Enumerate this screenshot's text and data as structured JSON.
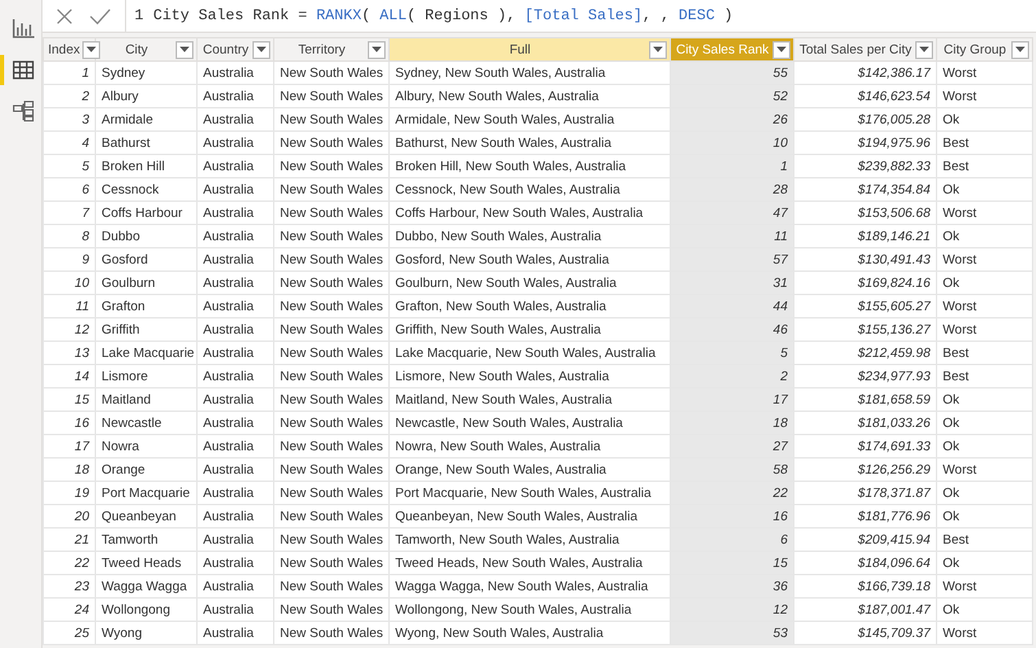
{
  "sidebar": {
    "items": [
      {
        "selected": false
      },
      {
        "selected": true
      },
      {
        "selected": false
      }
    ]
  },
  "formula_bar": {
    "line_number": "1",
    "tokens": [
      {
        "kind": "plain",
        "text": "City Sales Rank = "
      },
      {
        "kind": "function",
        "text": "RANKX"
      },
      {
        "kind": "plain",
        "text": "( "
      },
      {
        "kind": "function",
        "text": "ALL"
      },
      {
        "kind": "plain",
        "text": "( Regions ), "
      },
      {
        "kind": "function",
        "text": "[Total Sales]"
      },
      {
        "kind": "plain",
        "text": ", , "
      },
      {
        "kind": "function",
        "text": "DESC"
      },
      {
        "kind": "plain",
        "text": " )"
      }
    ]
  },
  "table": {
    "columns": [
      {
        "label": "Index",
        "kind": "number",
        "selected": false,
        "hovered": false
      },
      {
        "label": "City",
        "kind": "text",
        "selected": false,
        "hovered": false
      },
      {
        "label": "Country",
        "kind": "text",
        "selected": false,
        "hovered": false
      },
      {
        "label": "Territory",
        "kind": "text",
        "selected": false,
        "hovered": false
      },
      {
        "label": "Full",
        "kind": "text",
        "selected": false,
        "hovered": true
      },
      {
        "label": "City Sales Rank",
        "kind": "number",
        "selected": true,
        "hovered": false
      },
      {
        "label": "Total Sales per City",
        "kind": "number",
        "selected": false,
        "hovered": false
      },
      {
        "label": "City Group",
        "kind": "text",
        "selected": false,
        "hovered": false
      }
    ],
    "rows": [
      [
        "1",
        "Sydney",
        "Australia",
        "New South Wales",
        "Sydney, New South Wales, Australia",
        "55",
        "$142,386.17",
        "Worst"
      ],
      [
        "2",
        "Albury",
        "Australia",
        "New South Wales",
        "Albury, New South Wales, Australia",
        "52",
        "$146,623.54",
        "Worst"
      ],
      [
        "3",
        "Armidale",
        "Australia",
        "New South Wales",
        "Armidale, New South Wales, Australia",
        "26",
        "$176,005.28",
        "Ok"
      ],
      [
        "4",
        "Bathurst",
        "Australia",
        "New South Wales",
        "Bathurst, New South Wales, Australia",
        "10",
        "$194,975.96",
        "Best"
      ],
      [
        "5",
        "Broken Hill",
        "Australia",
        "New South Wales",
        "Broken Hill, New South Wales, Australia",
        "1",
        "$239,882.33",
        "Best"
      ],
      [
        "6",
        "Cessnock",
        "Australia",
        "New South Wales",
        "Cessnock, New South Wales, Australia",
        "28",
        "$174,354.84",
        "Ok"
      ],
      [
        "7",
        "Coffs Harbour",
        "Australia",
        "New South Wales",
        "Coffs Harbour, New South Wales, Australia",
        "47",
        "$153,506.68",
        "Worst"
      ],
      [
        "8",
        "Dubbo",
        "Australia",
        "New South Wales",
        "Dubbo, New South Wales, Australia",
        "11",
        "$189,146.21",
        "Ok"
      ],
      [
        "9",
        "Gosford",
        "Australia",
        "New South Wales",
        "Gosford, New South Wales, Australia",
        "57",
        "$130,491.43",
        "Worst"
      ],
      [
        "10",
        "Goulburn",
        "Australia",
        "New South Wales",
        "Goulburn, New South Wales, Australia",
        "31",
        "$169,824.16",
        "Ok"
      ],
      [
        "11",
        "Grafton",
        "Australia",
        "New South Wales",
        "Grafton, New South Wales, Australia",
        "44",
        "$155,605.27",
        "Worst"
      ],
      [
        "12",
        "Griffith",
        "Australia",
        "New South Wales",
        "Griffith, New South Wales, Australia",
        "46",
        "$155,136.27",
        "Worst"
      ],
      [
        "13",
        "Lake Macquarie",
        "Australia",
        "New South Wales",
        "Lake Macquarie, New South Wales, Australia",
        "5",
        "$212,459.98",
        "Best"
      ],
      [
        "14",
        "Lismore",
        "Australia",
        "New South Wales",
        "Lismore, New South Wales, Australia",
        "2",
        "$234,977.93",
        "Best"
      ],
      [
        "15",
        "Maitland",
        "Australia",
        "New South Wales",
        "Maitland, New South Wales, Australia",
        "17",
        "$181,658.59",
        "Ok"
      ],
      [
        "16",
        "Newcastle",
        "Australia",
        "New South Wales",
        "Newcastle, New South Wales, Australia",
        "18",
        "$181,033.26",
        "Ok"
      ],
      [
        "17",
        "Nowra",
        "Australia",
        "New South Wales",
        "Nowra, New South Wales, Australia",
        "27",
        "$174,691.33",
        "Ok"
      ],
      [
        "18",
        "Orange",
        "Australia",
        "New South Wales",
        "Orange, New South Wales, Australia",
        "58",
        "$126,256.29",
        "Worst"
      ],
      [
        "19",
        "Port Macquarie",
        "Australia",
        "New South Wales",
        "Port Macquarie, New South Wales, Australia",
        "22",
        "$178,371.87",
        "Ok"
      ],
      [
        "20",
        "Queanbeyan",
        "Australia",
        "New South Wales",
        "Queanbeyan, New South Wales, Australia",
        "16",
        "$181,776.96",
        "Ok"
      ],
      [
        "21",
        "Tamworth",
        "Australia",
        "New South Wales",
        "Tamworth, New South Wales, Australia",
        "6",
        "$209,415.94",
        "Best"
      ],
      [
        "22",
        "Tweed Heads",
        "Australia",
        "New South Wales",
        "Tweed Heads, New South Wales, Australia",
        "15",
        "$184,096.64",
        "Ok"
      ],
      [
        "23",
        "Wagga Wagga",
        "Australia",
        "New South Wales",
        "Wagga Wagga, New South Wales, Australia",
        "36",
        "$166,739.18",
        "Worst"
      ],
      [
        "24",
        "Wollongong",
        "Australia",
        "New South Wales",
        "Wollongong, New South Wales, Australia",
        "12",
        "$187,001.47",
        "Ok"
      ],
      [
        "25",
        "Wyong",
        "Australia",
        "New South Wales",
        "Wyong, New South Wales, Australia",
        "53",
        "$145,709.37",
        "Worst"
      ]
    ]
  }
}
